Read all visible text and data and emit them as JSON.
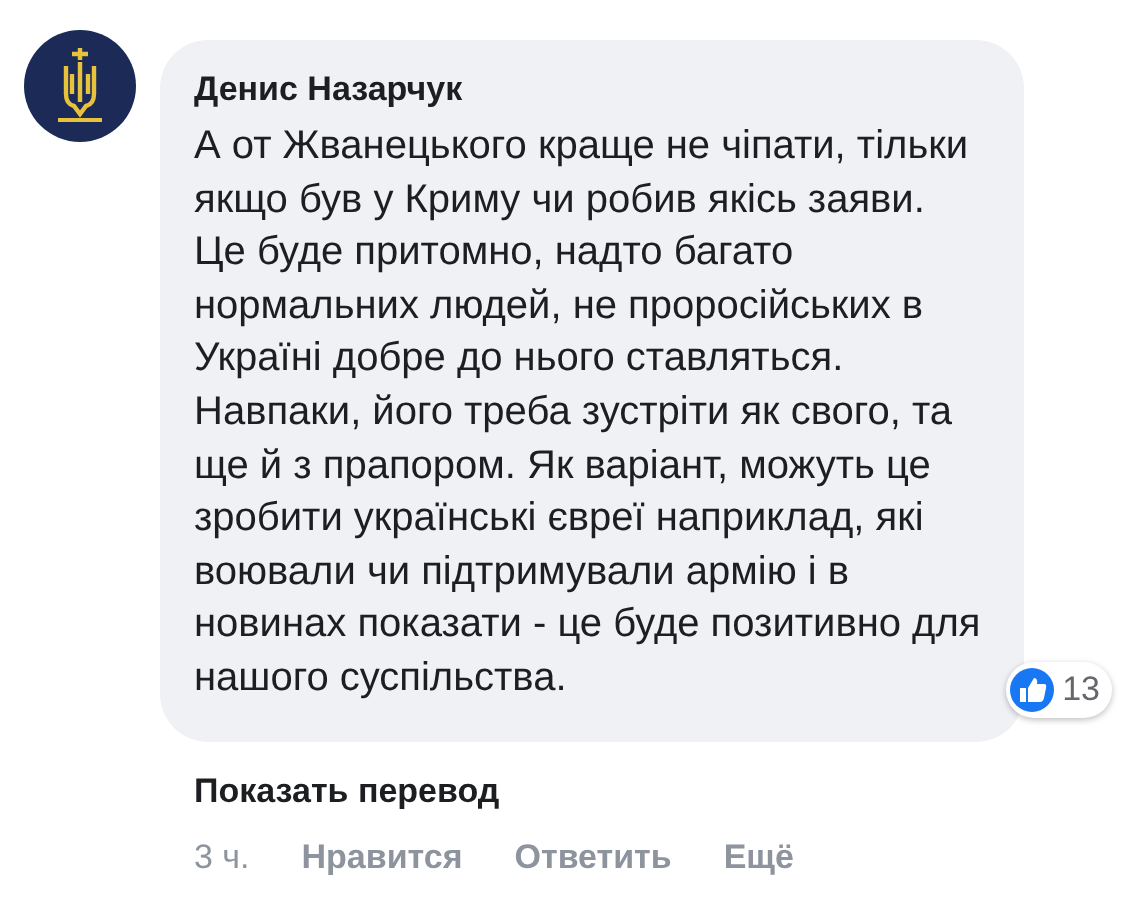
{
  "comment": {
    "author": "Денис Назарчук",
    "text": "А от Жванецького краще не чіпати, тільки якщо був у Криму чи робив якісь заяви. Це буде притомно, надто багато нормальних людей, не проросійських в Україні добре до нього ставляться. Навпаки, його треба зустріти як свого, та ще й з прапором. Як варіант, можуть це зробити українські євреї наприклад, які воювали чи підтримували армію і в новинах показати - це буде позитивно для нашого суспільства.",
    "reactions": {
      "count": "13"
    },
    "translate_link": "Показать перевод",
    "time": "3 ч.",
    "actions": [
      "Нравится",
      "Ответить",
      "Ещё"
    ]
  }
}
